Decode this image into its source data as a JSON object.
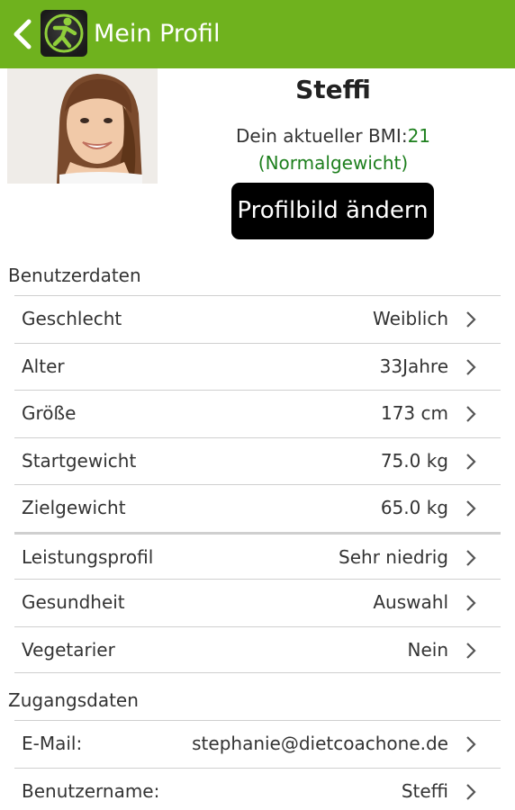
{
  "appbar": {
    "title": "Mein Profil",
    "back_icon": "chevron-left-icon",
    "logo_icon": "runner-logo-icon",
    "color": "#6fb21e"
  },
  "profile": {
    "name": "Steffi",
    "bmi_label": "Dein aktueller BMI:",
    "bmi_value": "21",
    "bmi_status": "(Normalgewicht)",
    "change_picture_label": "Profilbild ändern",
    "status_color": "#1d7f1d"
  },
  "sections": {
    "user_data_title": "Benutzerdaten",
    "access_data_title": "Zugangsdaten"
  },
  "user_rows": [
    {
      "label": "Geschlecht",
      "value": "Weiblich"
    },
    {
      "label": "Alter",
      "value": "33Jahre"
    },
    {
      "label": "Größe",
      "value": "173 cm"
    },
    {
      "label": "Startgewicht",
      "value": "75.0 kg"
    },
    {
      "label": "Zielgewicht",
      "value": "65.0 kg"
    },
    {
      "label": "Leistungsprofil",
      "value": "Sehr niedrig"
    },
    {
      "label": "Gesundheit",
      "value": "Auswahl"
    },
    {
      "label": "Vegetarier",
      "value": "Nein"
    }
  ],
  "access_rows": [
    {
      "label": "E-Mail:",
      "value": "stephanie@dietcoachone.de"
    },
    {
      "label": "Benutzername:",
      "value": "Steffi"
    }
  ]
}
